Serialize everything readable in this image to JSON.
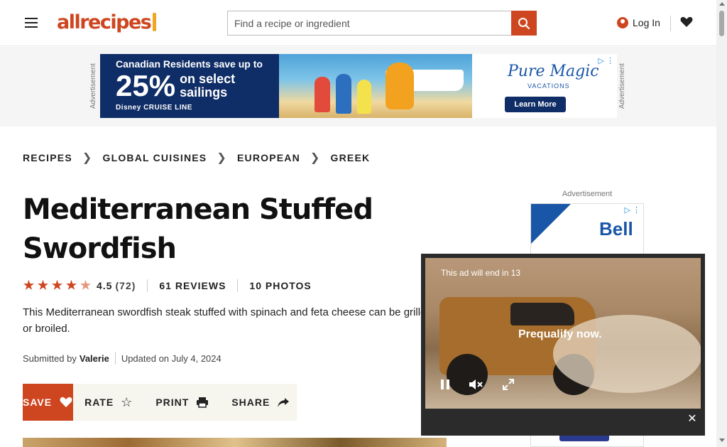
{
  "header": {
    "logo_text": "allrecipes",
    "search_placeholder": "Find a recipe or ingredient",
    "login_label": "Log In"
  },
  "top_ad": {
    "side_label": "Advertisement",
    "headline": "Canadian Residents save up to",
    "percent": "25%",
    "offer_line1": "on select",
    "offer_line2": "sailings",
    "brand": "Disney CRUISE LINE",
    "right_title": "Pure Magic",
    "right_sub": "VACATIONS",
    "cta": "Learn More"
  },
  "breadcrumbs": [
    "RECIPES",
    "GLOBAL CUISINES",
    "EUROPEAN",
    "GREEK"
  ],
  "recipe": {
    "title": "Mediterranean Stuffed Swordfish",
    "rating": "4.5",
    "rating_stars": 4.5,
    "rating_count": "(72)",
    "reviews": "61 REVIEWS",
    "photos": "10 PHOTOS",
    "description": "This Mediterranean swordfish steak stuffed with spinach and feta cheese can be grilled or broiled.",
    "submitted_label": "Submitted by",
    "author": "Valerie",
    "updated": "Updated on July 4, 2024"
  },
  "actions": {
    "save": "SAVE",
    "rate": "RATE",
    "print": "PRINT",
    "share": "SHARE"
  },
  "side_ad": {
    "label": "Advertisement",
    "brand": "Bell"
  },
  "video_ad": {
    "countdown": "This ad will end in 13",
    "tagline": "Prequalify now."
  },
  "colors": {
    "brand": "#ce4620",
    "ad_blue": "#0f2d66"
  }
}
